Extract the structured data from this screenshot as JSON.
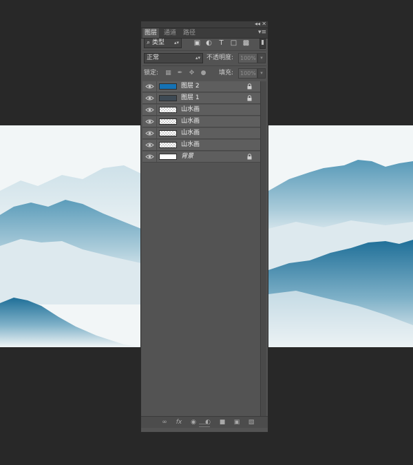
{
  "panel": {
    "collapse_icon": "double-chevron-left-icon",
    "close_icon": "close-icon",
    "tabs": [
      {
        "label": "图层",
        "active": true
      },
      {
        "label": "通道",
        "active": false
      },
      {
        "label": "路径",
        "active": false
      }
    ],
    "menu_icon": "panel-menu-icon"
  },
  "filter": {
    "kind_label": "类型",
    "icons": [
      "pixel-filter-icon",
      "adjustment-filter-icon",
      "type-filter-icon",
      "shape-filter-icon",
      "smart-object-filter-icon"
    ]
  },
  "blend": {
    "mode": "正常",
    "opacity_label": "不透明度:",
    "opacity_value": "100%"
  },
  "lock": {
    "label": "锁定:",
    "fill_label": "填充:",
    "fill_value": "100%"
  },
  "layers": [
    {
      "name": "图层 2",
      "thumb": "solid",
      "thumb_color": "#1572b4",
      "locked": true,
      "italic": false
    },
    {
      "name": "图层 1",
      "thumb": "solid",
      "thumb_color": "#3e4a54",
      "locked": true,
      "italic": false
    },
    {
      "name": "山水画",
      "thumb": "checker",
      "locked": false,
      "italic": false
    },
    {
      "name": "山水画",
      "thumb": "checker",
      "locked": false,
      "italic": false
    },
    {
      "name": "山水画",
      "thumb": "checker",
      "locked": false,
      "italic": false
    },
    {
      "name": "山水画",
      "thumb": "checker",
      "locked": false,
      "italic": false
    },
    {
      "name": "背景",
      "thumb": "solid",
      "thumb_color": "#ffffff",
      "locked": true,
      "italic": true
    }
  ],
  "bottom_icons": [
    "link-icon",
    "fx-icon",
    "mask-icon",
    "adjustment-layer-icon",
    "folder-icon",
    "new-layer-icon",
    "trash-icon"
  ],
  "colors": {
    "app_bg": "#282828",
    "panel_bg": "#535353",
    "mountain_blue": "#2b7fa8",
    "canvas_bg": "#f2f6f7"
  }
}
